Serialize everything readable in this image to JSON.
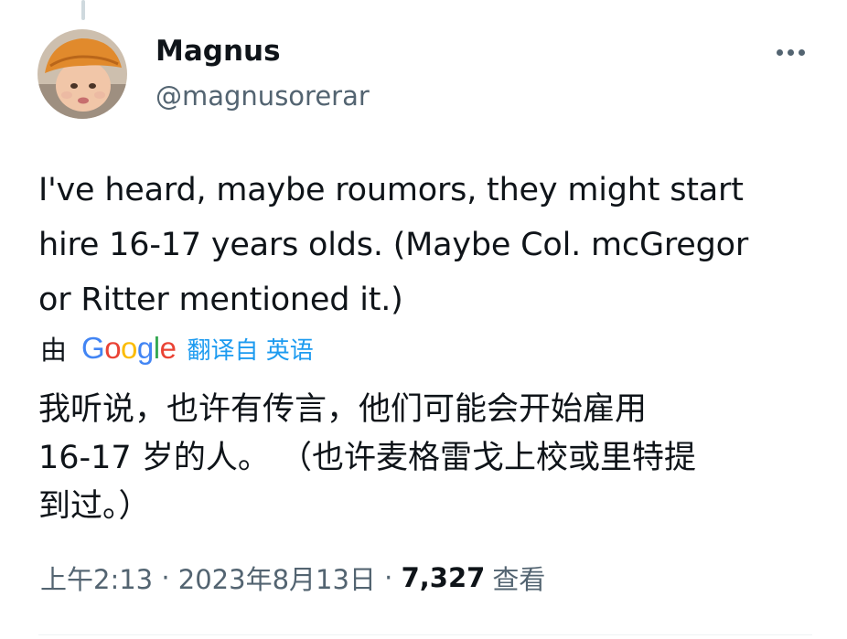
{
  "author": {
    "display_name": "Magnus",
    "handle": "@magnusorerar",
    "avatar_icon": "avatar-child-orange-hat-icon"
  },
  "more_menu": {
    "icon": "more-horizontal-icon"
  },
  "tweet": {
    "text_lines": [
      "I've heard, maybe roumors, they might start",
      "hire 16-17 years olds. (Maybe Col. mcGregor",
      "or Ritter mentioned it.)"
    ]
  },
  "translation": {
    "by_label": "由",
    "provider": "Google",
    "action_label": "翻译自 英语",
    "text_lines": [
      "我听说，也许有传言，他们可能会开始雇用",
      "16-17 岁的人。 （也许麦格雷戈上校或里特提",
      "到过。）"
    ]
  },
  "meta": {
    "time": "上午2:13",
    "separator": " · ",
    "date": "2023年8月13日",
    "views_count": "7,327",
    "views_label": "查看"
  },
  "colors": {
    "text": "#0f1419",
    "secondary": "#536471",
    "link": "#1d9bf0",
    "google_blue": "#4285F4",
    "google_red": "#EA4335",
    "google_yellow": "#FBBC05",
    "google_green": "#34A853"
  }
}
